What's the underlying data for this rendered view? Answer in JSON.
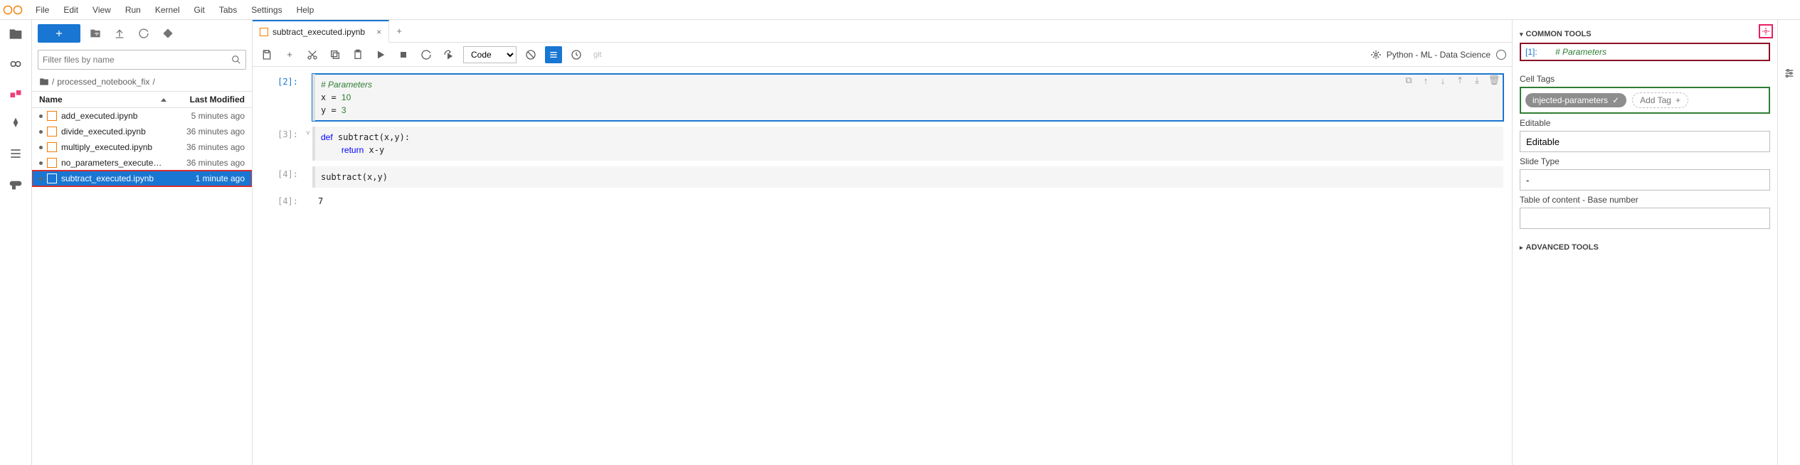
{
  "menubar": [
    "File",
    "Edit",
    "View",
    "Run",
    "Kernel",
    "Git",
    "Tabs",
    "Settings",
    "Help"
  ],
  "filebrowser": {
    "filter_placeholder": "Filter files by name",
    "breadcrumb_parts": [
      "/",
      "processed_notebook_fix",
      "/"
    ],
    "header_name": "Name",
    "header_mod": "Last Modified",
    "files": [
      {
        "name": "add_executed.ipynb",
        "mod": "5 minutes ago",
        "selected": false
      },
      {
        "name": "divide_executed.ipynb",
        "mod": "36 minutes ago",
        "selected": false
      },
      {
        "name": "multiply_executed.ipynb",
        "mod": "36 minutes ago",
        "selected": false
      },
      {
        "name": "no_parameters_executed.ipynb",
        "mod": "36 minutes ago",
        "selected": false
      },
      {
        "name": "subtract_executed.ipynb",
        "mod": "1 minute ago",
        "selected": true
      }
    ]
  },
  "notebook": {
    "tab_name": "subtract_executed.ipynb",
    "celltype": "Code",
    "git_label": "git",
    "kernel": "Python - ML - Data Science",
    "cells": [
      {
        "prompt": "[2]:",
        "code": "# Parameters\nx = 10\ny = 3",
        "highlight": true
      },
      {
        "prompt": "[3]:",
        "code": "def subtract(x,y):\n    return x-y"
      },
      {
        "prompt": "[4]:",
        "code": "subtract(x,y)"
      },
      {
        "prompt": "[4]:",
        "out": "7"
      }
    ]
  },
  "rightpanel": {
    "common_tools": "COMMON TOOLS",
    "preview_prompt": "[1]:",
    "preview_code": "# Parameters",
    "cell_tags_label": "Cell Tags",
    "tag": "injected-parameters",
    "add_tag": "Add Tag",
    "editable_label": "Editable",
    "editable_value": "Editable",
    "slide_label": "Slide Type",
    "slide_value": "-",
    "toc_label": "Table of content - Base number",
    "toc_value": "",
    "advanced": "ADVANCED TOOLS"
  }
}
